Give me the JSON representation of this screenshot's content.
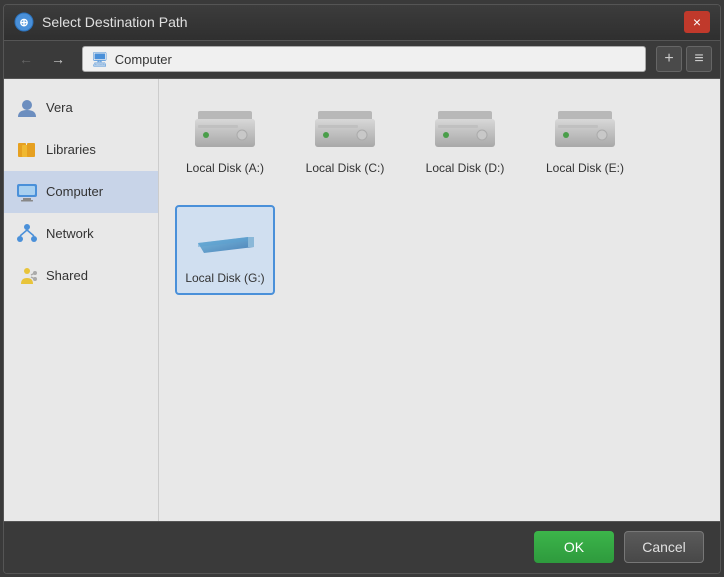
{
  "dialog": {
    "title": "Select Destination Path",
    "close_label": "×"
  },
  "toolbar": {
    "back_label": "←",
    "forward_label": "→",
    "address": "Computer",
    "new_folder_label": "+",
    "view_label": "≡"
  },
  "sidebar": {
    "items": [
      {
        "id": "vera",
        "label": "Vera",
        "icon": "user"
      },
      {
        "id": "libraries",
        "label": "Libraries",
        "icon": "library"
      },
      {
        "id": "computer",
        "label": "Computer",
        "icon": "computer",
        "active": true
      },
      {
        "id": "network",
        "label": "Network",
        "icon": "network"
      },
      {
        "id": "shared",
        "label": "Shared",
        "icon": "shared"
      }
    ]
  },
  "main": {
    "disks": [
      {
        "id": "a",
        "label": "Local Disk (A:)",
        "type": "hdd"
      },
      {
        "id": "c",
        "label": "Local Disk (C:)",
        "type": "hdd"
      },
      {
        "id": "d",
        "label": "Local Disk (D:)",
        "type": "hdd"
      },
      {
        "id": "e",
        "label": "Local Disk (E:)",
        "type": "hdd"
      },
      {
        "id": "g",
        "label": "Local Disk (G:)",
        "type": "usb",
        "selected": true
      }
    ]
  },
  "footer": {
    "ok_label": "OK",
    "cancel_label": "Cancel"
  },
  "colors": {
    "accent": "#3cb54a",
    "selected_bg": "#d0dff0",
    "active_sidebar": "#c8d4e8"
  }
}
